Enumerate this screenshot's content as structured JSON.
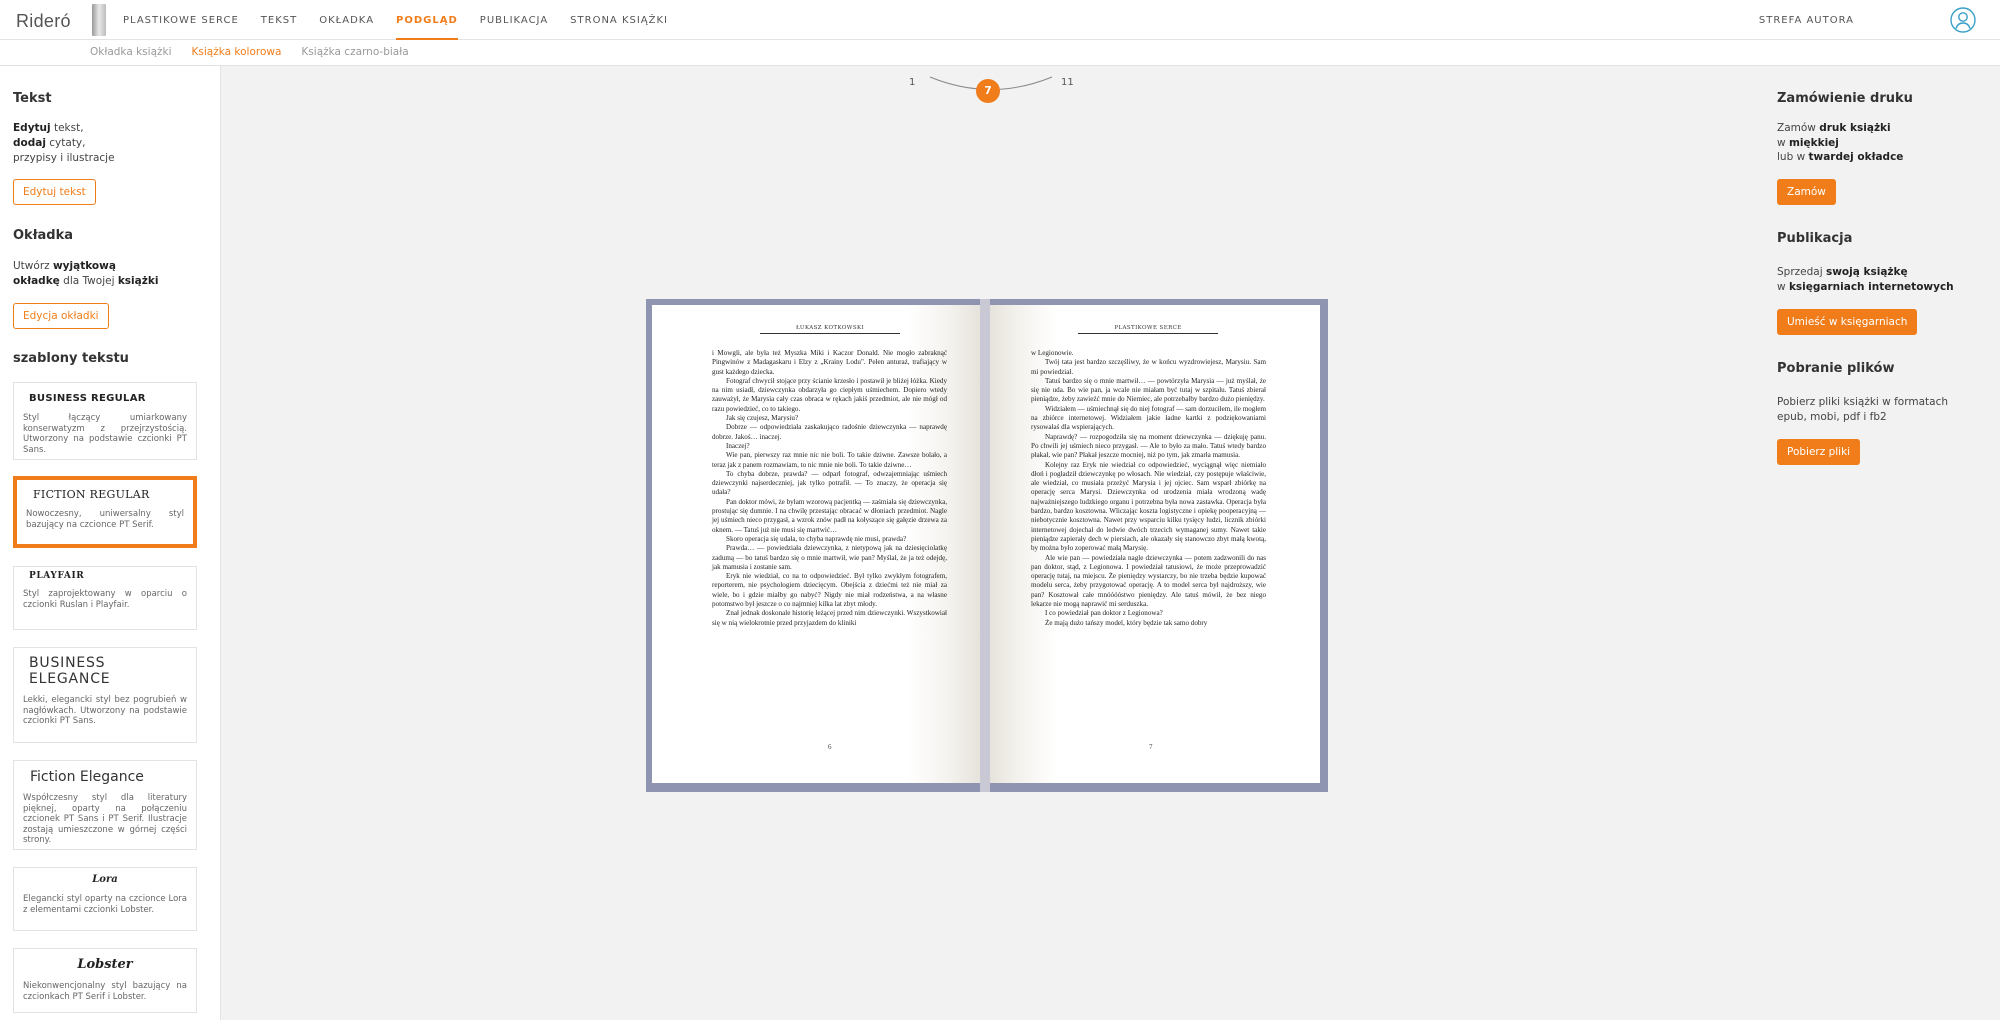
{
  "header": {
    "logo": "Rideró",
    "nav": [
      "PLASTIKOWE SERCE",
      "TEKST",
      "OKŁADKA",
      "PODGLĄD",
      "PUBLIKACJA",
      "STRONA KSIĄŻKI"
    ],
    "active_nav": "PODGLĄD",
    "author_zone": "STREFA AUTORA",
    "user_icon": "user-circle-icon"
  },
  "subnav": {
    "items": [
      "Okładka książki",
      "Książka kolorowa",
      "Książka czarno-biała"
    ],
    "active": "Książka kolorowa"
  },
  "left": {
    "text_section": {
      "title": "Tekst",
      "line1_bold": "Edytuj",
      "line1_rest": " tekst,",
      "line2_bold": "dodaj",
      "line2_rest": " cytaty,",
      "line3": "przypisy i ilustracje",
      "button": "Edytuj tekst"
    },
    "cover_section": {
      "title": "Okładka",
      "line1_start": "Utwórz ",
      "line1_bold": "wyjątkową",
      "line2_bold": "okładkę",
      "line2_mid": " dla Twojej ",
      "line2_bold2": "książki",
      "button": "Edycja okładki"
    },
    "templates_title": "szablony tekstu",
    "templates": [
      {
        "title": "BUSINESS REGULAR",
        "desc": "Styl łączący umiarkowany konserwatyzm z przejrzystością. Utworzony na podstawie czcionki PT Sans."
      },
      {
        "title": "FICTION REGULAR",
        "desc": "Nowoczesny, uniwersalny styl bazujący na czcionce PT Serif."
      },
      {
        "title": "PLAYFAIR",
        "desc": "Styl zaprojektowany w oparciu o czcionki Ruslan i Playfair."
      },
      {
        "title": "BUSINESS ELEGANCE",
        "desc": "Lekki, elegancki styl bez pogrubień w nagłówkach. Utworzony na podstawie czcionki PT Sans."
      },
      {
        "title": "Fiction Elegance",
        "desc": "Współczesny styl dla literatury pięknej, oparty na połączeniu czcionek PT Sans i PT Serif. Ilustracje zostają umieszczone w górnej części strony."
      },
      {
        "title": "Lora",
        "desc": "Elegancki styl oparty na czcionce Lora z elementami czcionki Lobster."
      },
      {
        "title": "Lobster",
        "desc": "Niekonwencjonalny styl bazujący na czcionkach PT Serif i Lobster."
      }
    ],
    "selected_template": "FICTION REGULAR"
  },
  "pager": {
    "start": "1",
    "current": "7",
    "end": "11"
  },
  "book": {
    "left_header": "ŁUKASZ KOTKOWSKI",
    "right_header": "PLASTIKOWE SERCE",
    "left_page_number": "6",
    "right_page_number": "7",
    "left_paragraphs": [
      "i Mowgli, ale była też Myszka Miki i Kaczor Donald. Nie mogło zabraknąć Pingwinów z Madagaskaru i Elzy z „Krainy Lodu\". Pełen anturaż, trafiający w gust każdego dziecka.",
      "Fotograf chwycił stojące przy ścianie krzesło i postawił je bliżej łóżka. Kiedy na nim usiadł, dziewczynka obdarzyła go ciepłym uśmiechem. Dopiero wtedy zauważył, że Marysia cały czas obraca w rękach jakiś przedmiot, ale nie mógł od razu powiedzieć, co to takiego.",
      "Jak się czujesz, Marysiu?",
      "Dobrze — odpowiedziała zaskakująco radośnie dziewczynka — naprawdę dobrze. Jakoś… inaczej.",
      "Inaczej?",
      "Wie pan, pierwszy raz mnie nic nie boli. To takie dziwne. Zawsze bolało, a teraz jak z panem rozmawiam, to nic mnie nie boli. To takie dziwne…",
      "To chyba dobrze, prawda? — odparł fotograf, odwzajemniając uśmiech dziewczynki najserdeczniej, jak tylko potrafił. — To znaczy, że operacja się udała?",
      "Pan doktor mówi, że byłam wzorową pacjentką — zaśmiała się dziewczynka, prostując się dumnie. I na chwilę przestając obracać w dłoniach przedmiot. Nagle jej uśmiech nieco przygasł, a wzrok znów padł na kołyszące się gałęzie drzewa za oknem. — Tatuś już nie musi się martwić…",
      "Skoro operacja się udała, to chyba naprawdę nie musi, prawda?",
      "Prawda… — powiedziała dziewczynka, z nietypową jak na dziesięciolatkę zadumą — bo tatuś bardzo się o mnie martwił, wie pan? Myślał, że ja też odejdę, jak mamusia i zostanie sam.",
      "Eryk nie wiedział, co na to odpowiedzieć. Był tylko zwykłym fotografem, reporterem, nie psychologiem dziecięcym. Obejścia z dziećmi też nie miał za wiele, bo i gdzie miałby go nabyć? Nigdy nie miał rodzeństwa, a na własne potomstwo był jeszcze o co najmniej kilka lat zbyt młody.",
      "Znał jednak doskonale historię leżącej przed nim dziewczynki. Wszystkowiał się w nią wielokrotnie przed przyjazdem do kliniki"
    ],
    "right_paragraphs": [
      "w Legionowie.",
      "Twój tata jest bardzo szczęśliwy, że w końcu wyzdrowiejesz, Marysiu. Sam mi powiedział.",
      "Tatuś bardzo się o mnie martwił… — powtórzyła Marysia — już myślał, że się nie uda. Bo wie pan, ja wcale nie miałam być tutaj w szpitalu. Tatuś zbierał pieniądze, żeby zawieźć mnie do Niemiec, ale potrzebałby bardzo dużo pieniędzy.",
      "Widziałem — uśmiechnął się do niej fotograf — sam dorzuciłem, ile mogłem na zbiórce internetowej. Widziałem jakie ładne kartki z podziękowaniami rysowałaś dla wspierających.",
      "Naprawdę? — rozpogodziła się na moment dziewczynka — dziękuję panu. Po chwili jej uśmiech nieco przygasł. — Ale to było za mało. Tatuś wtedy bardzo płakał, wie pan? Płakał jeszcze mocniej, niż po tym, jak zmarła mamusia.",
      "Kolejny raz Eryk nie wiedział co odpowiedzieć, wyciągnął więc niemiało dłoń i pogładził dziewczynkę po włosach. Nie wiedział, czy postępuje właściwie, ale wiedział, co musiała przeżyć Marysia i jej ojciec. Sam wsparł zbiórkę na operację serca Marysi. Dziewczynka od urodzenia miała wrodzoną wadę najważniejszego ludzkiego organu i potrzebna była nowa zastawka. Operacja była bardzo, bardzo kosztowna. Wliczając koszta logistyczne i opiekę pooperacyjną — niebotycznie kosztowna. Nawet przy wsparciu kilku tysięcy ludzi, licznik zbiórki internetowej dojechał do ledwie dwóch trzecich wymaganej sumy. Nawet takie pieniądze zapierały dech w piersiach, ale okazały się stanowczo zbyt małą kwotą, by można było zoperować małą Marysię.",
      "Ale wie pan — powiedziała nagle dziewczynka — potem zadzwonili do nas pan doktor, stąd, z Legionowa. I powiedział tatusiowi, że może przeprowadzić operację tutaj, na miejscu. Że pieniędzy wystarczy, bo nie trzeba będzie kupować modelu serca, żeby przygotować operację. A to model serca był najdroższy, wie pan? Kosztował całe mnóóóóstwo pieniędzy. Ale tatuś mówił, że bez niego lekarze nie mogą naprawić mi serduszka.",
      "I co powiedział pan doktor z Legionowa?",
      "Że mają dużo tańszy model, który będzie tak samo dobry"
    ]
  },
  "right": {
    "print": {
      "title": "Zamówienie druku",
      "l1_start": "Zamów ",
      "l1_bold": "druk książki",
      "l2_start": "w ",
      "l2_bold": "miękkiej",
      "l3_start": "lub w ",
      "l3_bold": "twardej okładce",
      "button": "Zamów"
    },
    "publish": {
      "title": "Publikacja",
      "l1_start": "Sprzedaj ",
      "l1_bold": "swoją książkę",
      "l2_start": "w ",
      "l2_bold": "księgarniach internetowych",
      "button": "Umieść w księgarniach"
    },
    "download": {
      "title": "Pobranie plików",
      "l1": "Pobierz pliki książki w formatach",
      "l2": "epub, mobi, pdf i fb2",
      "button": "Pobierz pliki"
    }
  },
  "colors": {
    "accent": "#f07d1a",
    "book_frame": "#8f94b1"
  }
}
